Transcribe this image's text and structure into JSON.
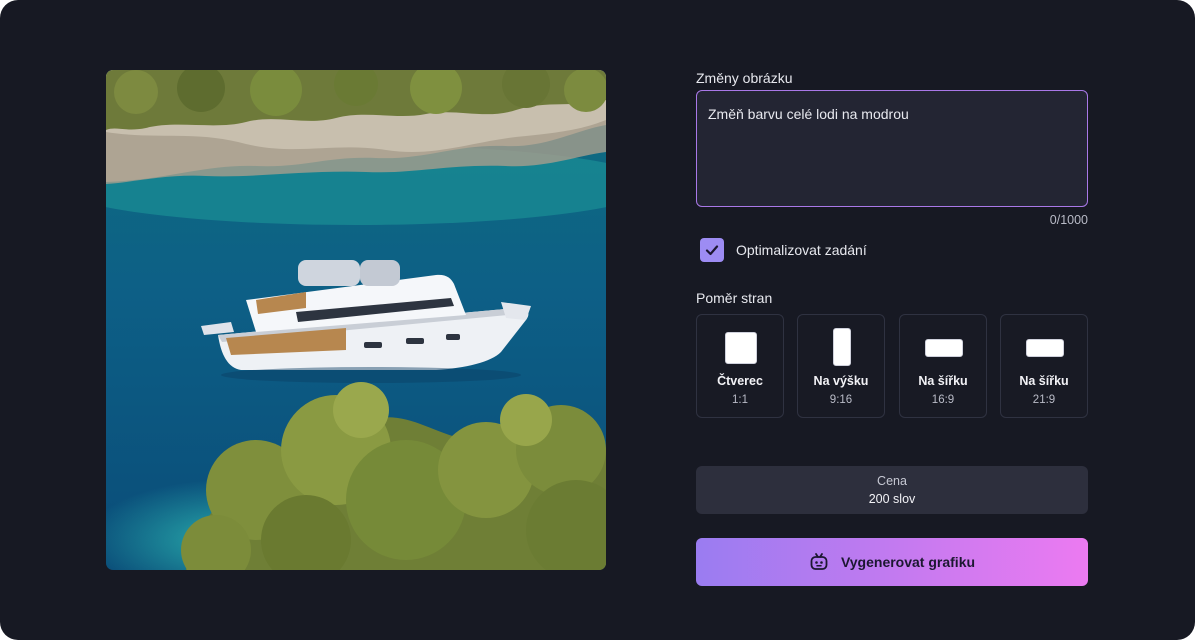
{
  "editor": {
    "image_changes_label": "Změny obrázku",
    "prompt_text": "Změň barvu celé lodi na modrou",
    "char_counter": "0/1000",
    "optimize_label": "Optimalizovat zadání",
    "optimize_checked": true
  },
  "aspect": {
    "label": "Poměr stran",
    "options": [
      {
        "name": "Čtverec",
        "ratio": "1:1"
      },
      {
        "name": "Na výšku",
        "ratio": "9:16"
      },
      {
        "name": "Na šířku",
        "ratio": "16:9"
      },
      {
        "name": "Na šířku",
        "ratio": "21:9"
      }
    ]
  },
  "price": {
    "label": "Cena",
    "value": "200 slov"
  },
  "generate": {
    "label": "Vygenerovat grafiku",
    "icon": "robot-icon"
  },
  "colors": {
    "background": "#171923",
    "accent_border": "#a978e8",
    "checkbox": "#9d8cf3",
    "button_gradient_start": "#9a7cf1",
    "button_gradient_end": "#ec7af1"
  }
}
